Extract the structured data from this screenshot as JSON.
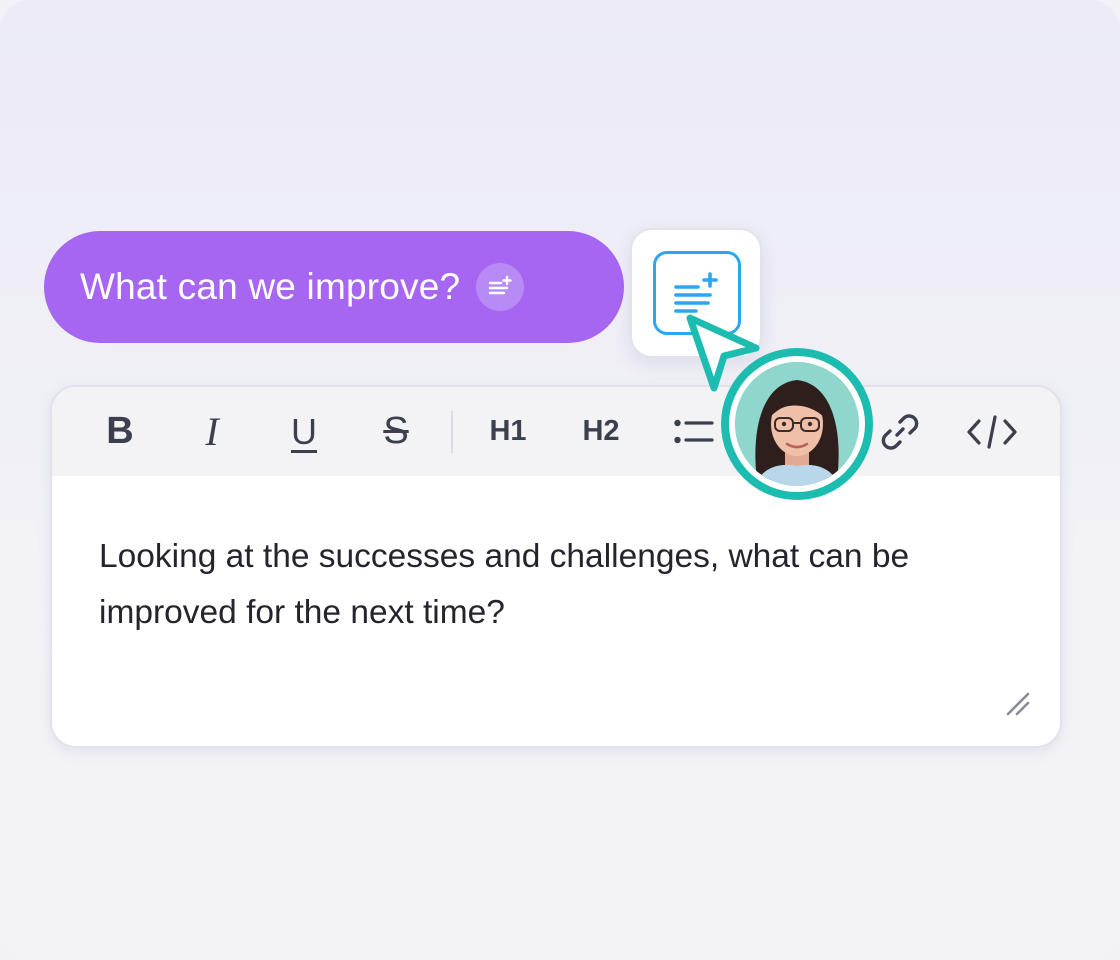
{
  "question": {
    "text": "What can we improve?",
    "pill_color": "#a666f1",
    "icon": "add-text-icon"
  },
  "floating_button": {
    "icon": "add-text-icon",
    "accent": "#2aa7f0"
  },
  "toolbar": {
    "bold": "B",
    "italic": "I",
    "underline": "U",
    "strikethrough": "S",
    "h1": "H1",
    "h2": "H2",
    "list_icon": "bulleted-list-icon",
    "link_icon": "link-icon",
    "code_icon": "code-icon"
  },
  "editor": {
    "text": "Looking at the successes and challenges, what can be improved for the next time?"
  },
  "cursor": {
    "color": "#1dbcb0",
    "avatar": "user-avatar"
  }
}
